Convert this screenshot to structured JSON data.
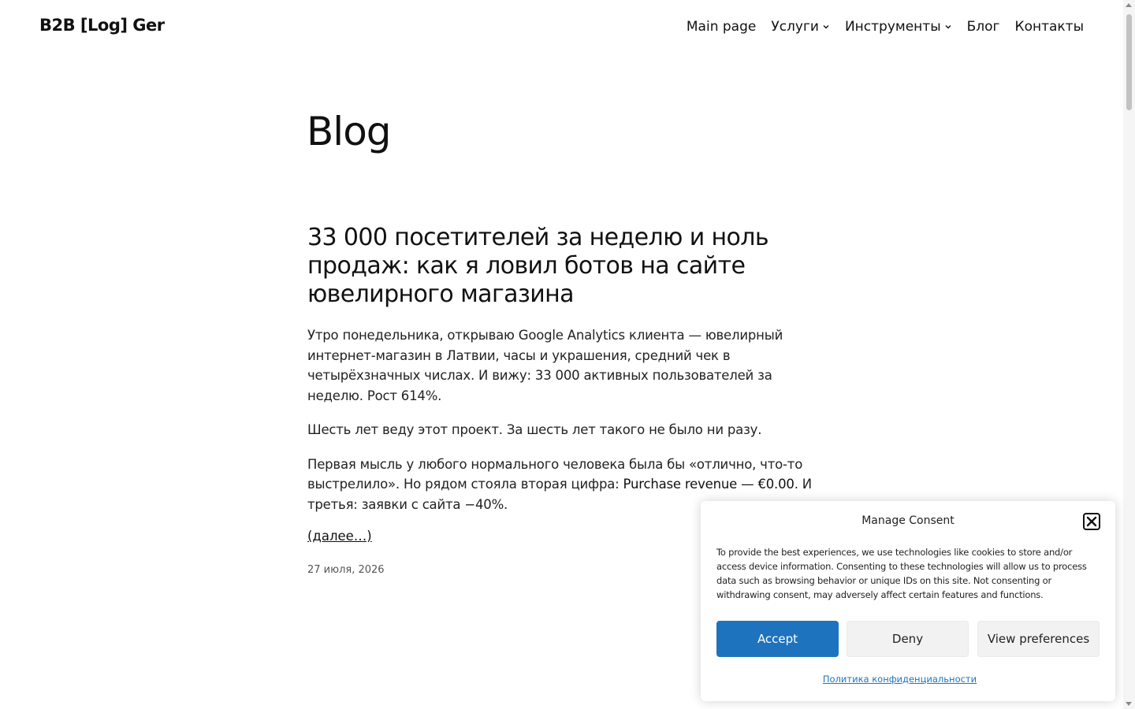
{
  "header": {
    "site_title": "B2B [Log] Ger",
    "nav": [
      {
        "label": "Main page"
      },
      {
        "label": "Услуги",
        "has_submenu": true
      },
      {
        "label": "Инструменты",
        "has_submenu": true
      },
      {
        "label": "Блог"
      },
      {
        "label": "Контакты"
      }
    ]
  },
  "main": {
    "page_title": "Blog",
    "post": {
      "title": "33 000 посетителей за неделю и ноль продаж: как я ловил ботов на сайте ювелирного магазина",
      "paragraph1": "Утро понедельника, открываю Google Analytics клиента — ювелирный интернет-магазин в Латвии, часы и украшения, средний чек в четырёхзначных числах. И вижу: 33 000 активных пользователей за неделю. Рост 614%.",
      "paragraph2": "Шесть лет веду этот проект. За шесть лет такого не было ни разу.",
      "paragraph3_start": "Первая мысль у любого нормального человека была бы «отлично, что-то выстрелило». Но рядом стояла вторая цифра: ",
      "paragraph3_strong": "Purchase revenue — €0.00",
      "paragraph3_end": ". И третья: заявки с сайта −40%.",
      "read_more": "(далее…)",
      "date": "27 июля, 2026"
    }
  },
  "consent": {
    "title": "Manage Consent",
    "text": "To provide the best experiences, we use technologies like cookies to store and/or access device information. Consenting to these technologies will allow us to process data such as browsing behavior or unique IDs on this site. Not consenting or withdrawing consent, may adversely affect certain features and functions.",
    "accept_label": "Accept",
    "deny_label": "Deny",
    "preferences_label": "View preferences",
    "privacy_link": "Политика конфиденциальности",
    "accent_color": "#1e73be"
  }
}
